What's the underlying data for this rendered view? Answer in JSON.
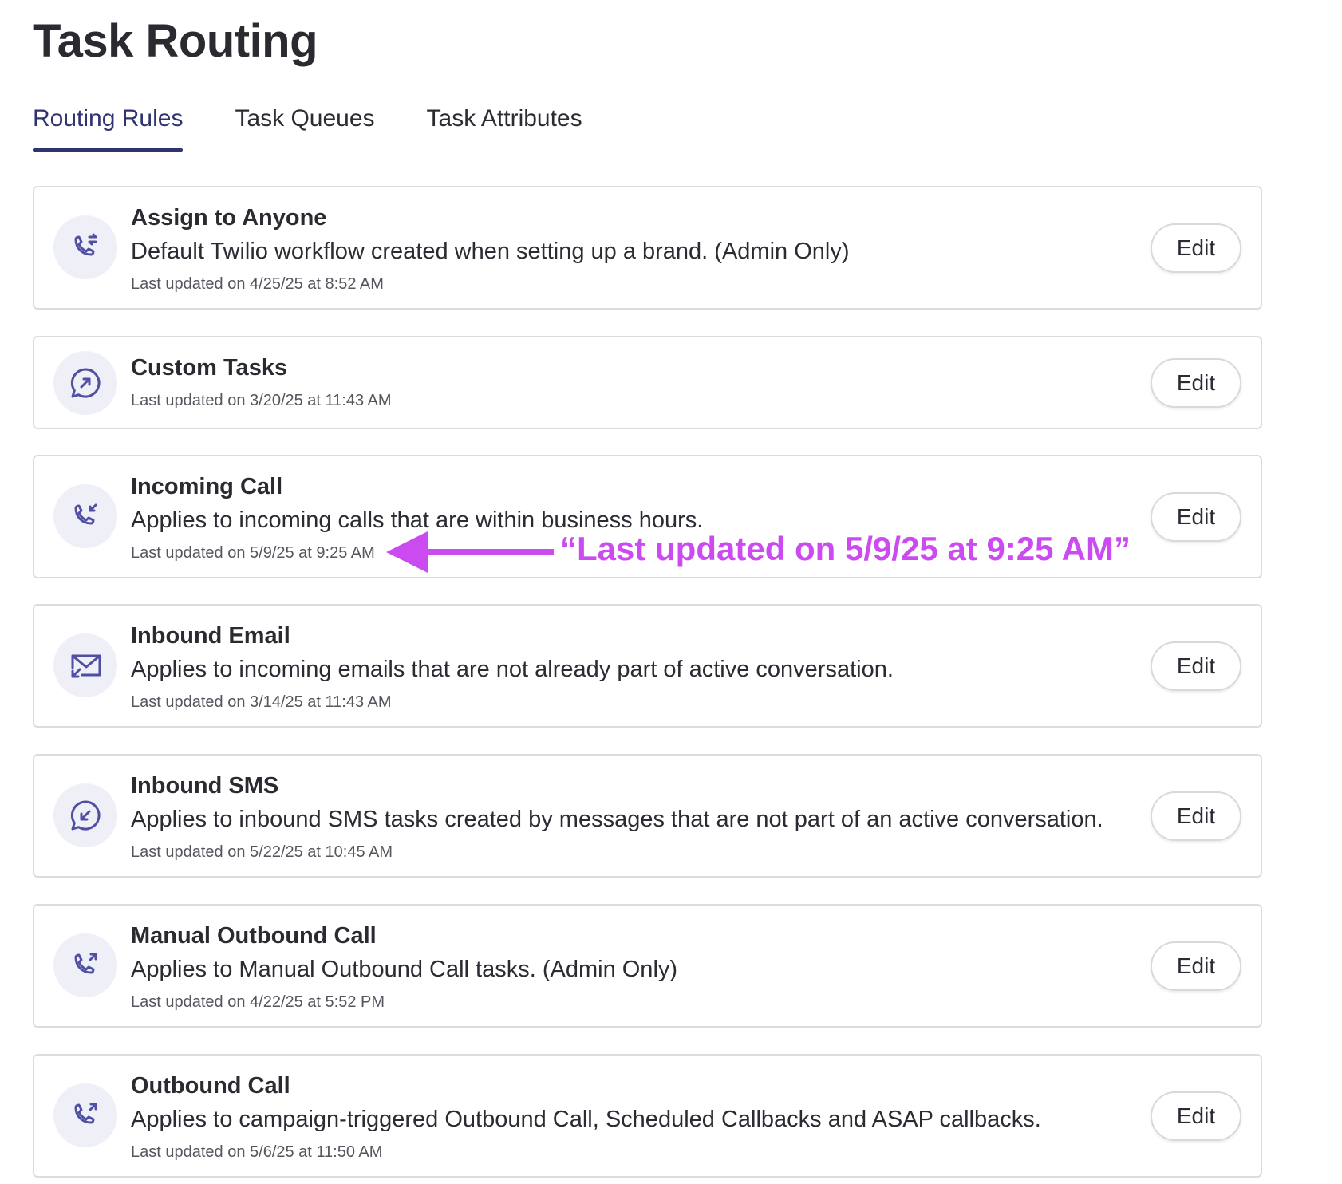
{
  "page": {
    "title": "Task Routing"
  },
  "tabs": [
    {
      "label": "Routing Rules",
      "active": true
    },
    {
      "label": "Task Queues",
      "active": false
    },
    {
      "label": "Task Attributes",
      "active": false
    }
  ],
  "rules": [
    {
      "icon": "phone-transfer-icon",
      "title": "Assign to Anyone",
      "description": "Default Twilio workflow created when setting up a brand. (Admin Only)",
      "updated": "Last updated on 4/25/25 at 8:52 AM",
      "edit_label": "Edit"
    },
    {
      "icon": "chat-outgoing-icon",
      "title": "Custom Tasks",
      "description": "",
      "updated": "Last updated on 3/20/25 at 11:43 AM",
      "edit_label": "Edit"
    },
    {
      "icon": "phone-incoming-icon",
      "title": "Incoming Call",
      "description": "Applies to incoming calls that are within business hours.",
      "updated": "Last updated on 5/9/25 at 9:25 AM",
      "edit_label": "Edit"
    },
    {
      "icon": "mail-inbound-icon",
      "title": "Inbound Email",
      "description": "Applies to incoming emails that are not already part of active conversation.",
      "updated": "Last updated on 3/14/25 at 11:43 AM",
      "edit_label": "Edit"
    },
    {
      "icon": "chat-incoming-icon",
      "title": "Inbound SMS",
      "description": "Applies to inbound SMS tasks created by messages that are not part of an active conversation.",
      "updated": "Last updated on 5/22/25 at 10:45 AM",
      "edit_label": "Edit"
    },
    {
      "icon": "phone-outgoing-icon",
      "title": "Manual Outbound Call",
      "description": "Applies to Manual Outbound Call tasks. (Admin Only)",
      "updated": "Last updated on 4/22/25 at 5:52 PM",
      "edit_label": "Edit"
    },
    {
      "icon": "phone-outgoing-icon",
      "title": "Outbound Call",
      "description": "Applies to campaign-triggered Outbound Call, Scheduled Callbacks and ASAP callbacks.",
      "updated": "Last updated on 5/6/25 at 11:50 AM",
      "edit_label": "Edit"
    }
  ],
  "annotation": {
    "text": "“Last updated on 5/9/25 at 9:25 AM”",
    "color": "#cc4bf0"
  },
  "colors": {
    "accent": "#2f3470",
    "icon": "#4f4fa3",
    "icon_bg": "#efeff8",
    "border": "#dcdce0"
  }
}
